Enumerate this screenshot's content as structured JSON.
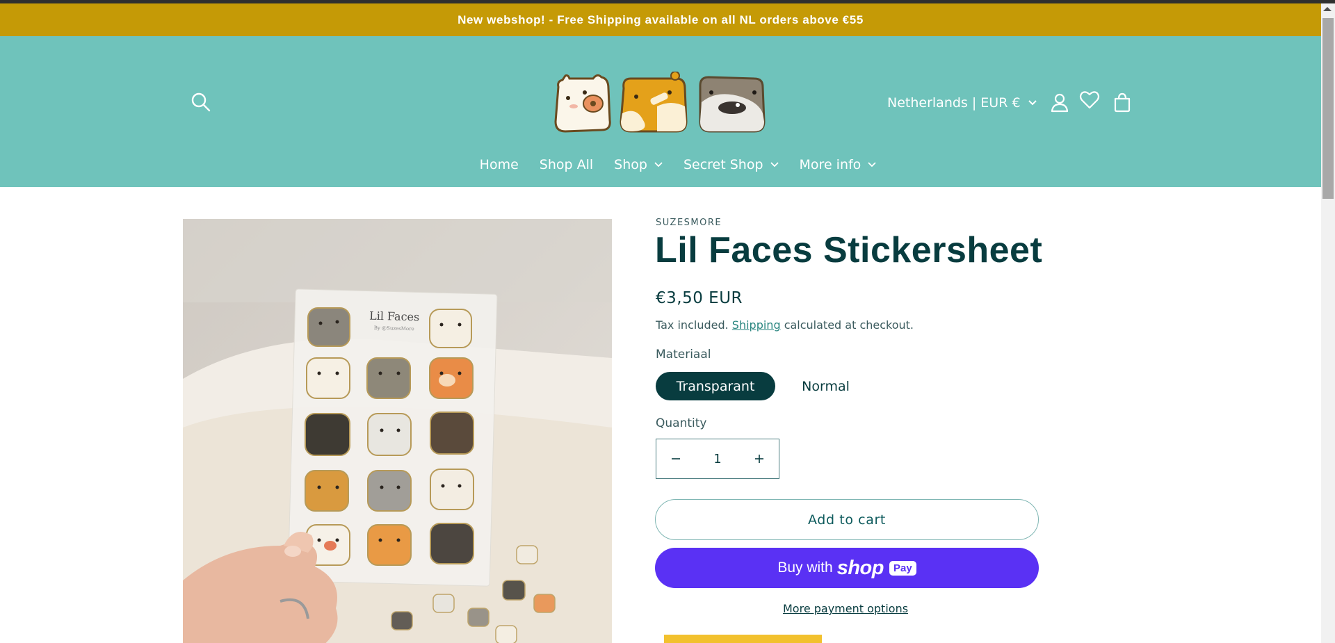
{
  "announcement": {
    "text": "New webshop! - Free Shipping available on all NL orders above €55"
  },
  "header": {
    "country_label": "Netherlands | EUR €",
    "icons": [
      "search-icon",
      "account-icon",
      "heart-icon",
      "cart-icon"
    ],
    "nav": [
      {
        "label": "Home",
        "dropdown": false
      },
      {
        "label": "Shop All",
        "dropdown": false
      },
      {
        "label": "Shop",
        "dropdown": true
      },
      {
        "label": "Secret Shop",
        "dropdown": true
      },
      {
        "label": "More info",
        "dropdown": true
      }
    ]
  },
  "product": {
    "vendor": "SUZESMORE",
    "title": "Lil Faces Stickersheet",
    "price": "€3,50 EUR",
    "tax_prefix": "Tax included.",
    "tax_link": "Shipping",
    "tax_suffix": "calculated at checkout.",
    "option_label": "Materiaal",
    "options": [
      "Transparant",
      "Normal"
    ],
    "selected_option": "Transparant",
    "quantity_label": "Quantity",
    "quantity": "1",
    "add_to_cart": "Add to cart",
    "buy_with": "Buy with",
    "shop_brand": "shop",
    "shop_pay": "Pay",
    "more_payment": "More payment options",
    "sheet_title": "Lil Faces",
    "sheet_subtitle": "By @SuzesMore"
  },
  "colors": {
    "announcement": "#c59a06",
    "header": "#6fc3bb",
    "primary": "#083c3f",
    "shop_pay": "#5a31f4"
  }
}
